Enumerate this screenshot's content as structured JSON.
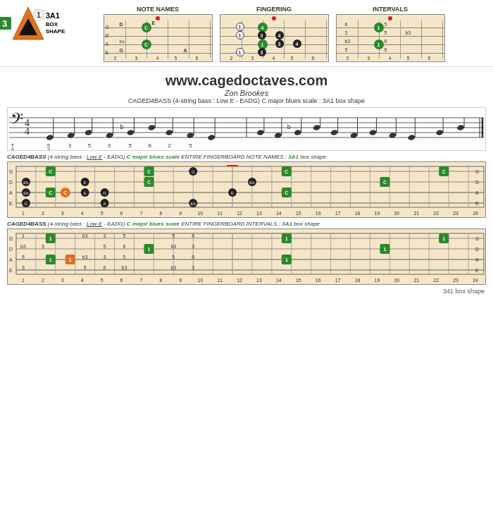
{
  "header": {
    "shape": "3A1",
    "shape_sub": "BOX\nSHAPE",
    "diagrams": [
      {
        "title": "NOTE NAMES"
      },
      {
        "title": "FINGERING"
      },
      {
        "title": "INTERVALS"
      }
    ]
  },
  "website": {
    "url": "www.cagedoctaves.com",
    "author": "Zon Brookes",
    "description": "CAGED4BASS (4-string bass : Low E - EADG) C major blues scale : 3A1 box shape"
  },
  "fingerboard1": {
    "title_parts": [
      "CAGED4BASS",
      " (4-string bass : ",
      "Low E",
      " - EADG) ",
      "C major blues scale",
      " ENTIRE FINGERBOARD NOTE NAMES : ",
      "3A1",
      " box shape"
    ]
  },
  "fingerboard2": {
    "title_parts": [
      "CAGED4BASS",
      " (4-string bass : ",
      "Low E",
      " - EADG) ",
      "C major blues scale",
      " ENTIRE FINGERBOARD INTERVALS : ",
      "3A1",
      " box shape"
    ]
  },
  "fret_numbers": [
    "1",
    "2",
    "3",
    "4",
    "5",
    "6",
    "7",
    "8",
    "9",
    "10",
    "11",
    "12",
    "13",
    "14",
    "15",
    "16",
    "17",
    "18",
    "19",
    "20",
    "21",
    "22",
    "23",
    "24"
  ],
  "bottom_label": "341 box shape",
  "colors": {
    "green": "#2a8a2a",
    "orange": "#e07020",
    "black": "#222222",
    "wood": "#f5e6c8",
    "red_dot": "#cc2222"
  }
}
